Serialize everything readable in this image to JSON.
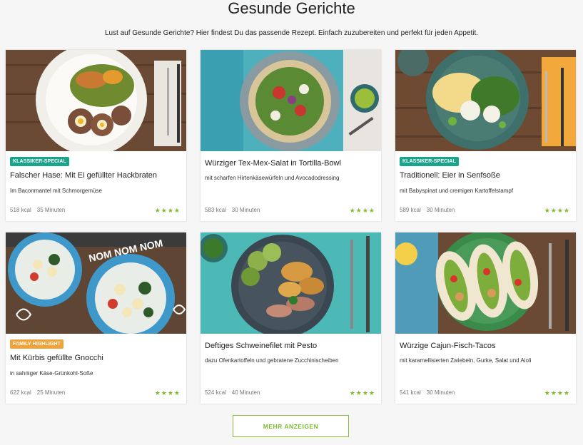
{
  "header": {
    "title": "Gesunde Gerichte",
    "subtitle": "Lust auf Gesunde Gerichte? Hier findest Du das passende Rezept. Einfach zuzubereiten und perfekt für jeden Appetit."
  },
  "colors": {
    "accent": "#7cbb2a",
    "badge_classic": "#1aa58b",
    "badge_family": "#f0a33b"
  },
  "recipes": [
    {
      "badge": "KLASSIKER-SPECIAL",
      "title": "Falscher Hase: Mit Ei gefüllter Hackbraten",
      "description": "Im Baconmantel mit Schmorgemüse",
      "kcal": "518 kcal",
      "time": "35 Minuten",
      "rating": "★★★★"
    },
    {
      "badge": "",
      "title": "Würziger Tex-Mex-Salat in Tortilla-Bowl",
      "description": "mit scharfen Hirtenkäsewürfeln und Avocadodressing",
      "kcal": "583 kcal",
      "time": "30 Minuten",
      "rating": "★★★★"
    },
    {
      "badge": "KLASSIKER-SPECIAL",
      "title": "Traditionell: Eier in Senfsoße",
      "description": "mit Babyspinat und cremigen Kartoffelstampf",
      "kcal": "589 kcal",
      "time": "30 Minuten",
      "rating": "★★★★"
    },
    {
      "badge": "FAMILY HIGHLIGHT",
      "title": "Mit Kürbis gefüllte Gnocchi",
      "description": "in sahniger Käse-Grünkohl-Soße",
      "kcal": "622 kcal",
      "time": "25 Minuten",
      "rating": "★★★★"
    },
    {
      "badge": "",
      "title": "Deftiges Schweinefilet mit Pesto",
      "description": "dazu Ofenkartoffeln und gebratene Zucchinischeiben",
      "kcal": "524 kcal",
      "time": "40 Minuten",
      "rating": "★★★★"
    },
    {
      "badge": "",
      "title": "Würzige Cajun-Fisch-Tacos",
      "description": "mit karamellisierten Zwiebeln, Gurke, Salat und Aioli",
      "kcal": "541 kcal",
      "time": "30 Minuten",
      "rating": "★★★★"
    }
  ],
  "image_text": {
    "nom": "NOM NOM NOM"
  },
  "more_button": "MEHR ANZEIGEN"
}
